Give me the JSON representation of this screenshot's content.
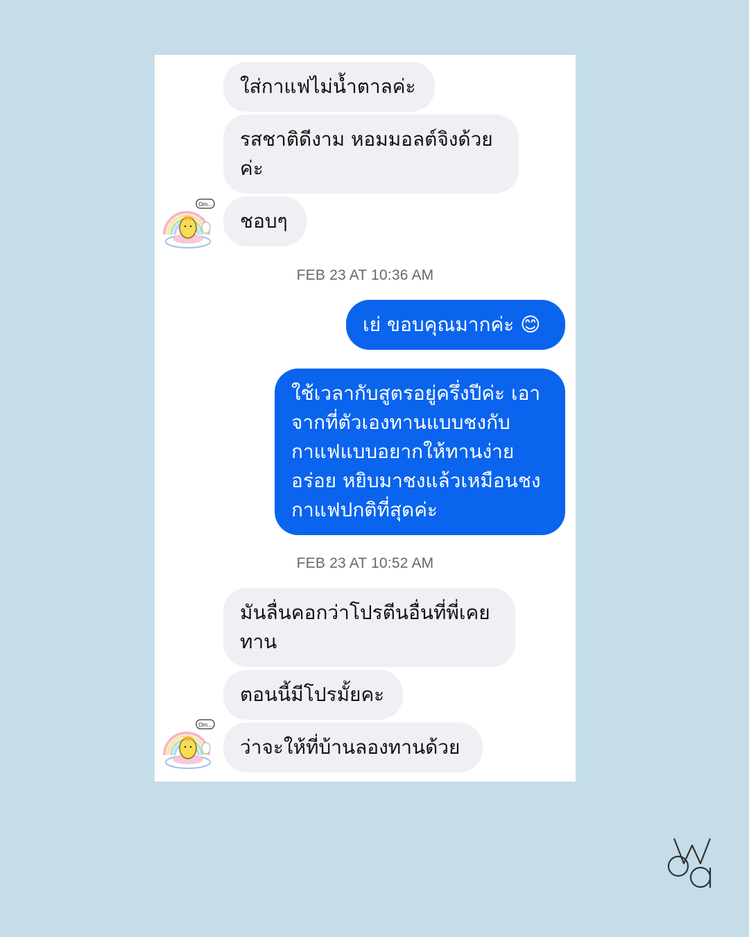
{
  "conversation": {
    "incoming_1": [
      "ใส่กาแฟไม่น้ำตาลค่ะ",
      "รสชาติดีงาม หอมมอลต์จิงด้วยค่ะ",
      "ชอบๆ"
    ],
    "timestamp_1": "FEB 23 AT 10:36 AM",
    "outgoing": [
      "เย่ ขอบคุณมากค่ะ 😊",
      "ใช้เวลากับสูตรอยู่ครึ่งปีค่ะ เอาจากที่ตัวเองทานแบบชงกับกาแฟแบบอยากให้ทานง่ายอร่อย หยิบมาชงแล้วเหมือนชงกาแฟปกติที่สุดค่ะ"
    ],
    "timestamp_2": "FEB 23 AT 10:52 AM",
    "incoming_2": [
      "มันลื่นคอกว่าโปรตีนอื่นที่พี่เคยทาน",
      "ตอนนี้มีโปรมั้ยคะ",
      "ว่าจะให้ที่บ้านลองทานด้วย"
    ],
    "avatar_sticker_text": "Om..."
  },
  "colors": {
    "page_background": "#c5dde8",
    "incoming_bubble": "#eff0f4",
    "outgoing_bubble": "#0a64ee",
    "timestamp_text": "#65676b"
  },
  "icons": [
    "avatar-sticker-icon",
    "brand-logo-icon"
  ]
}
